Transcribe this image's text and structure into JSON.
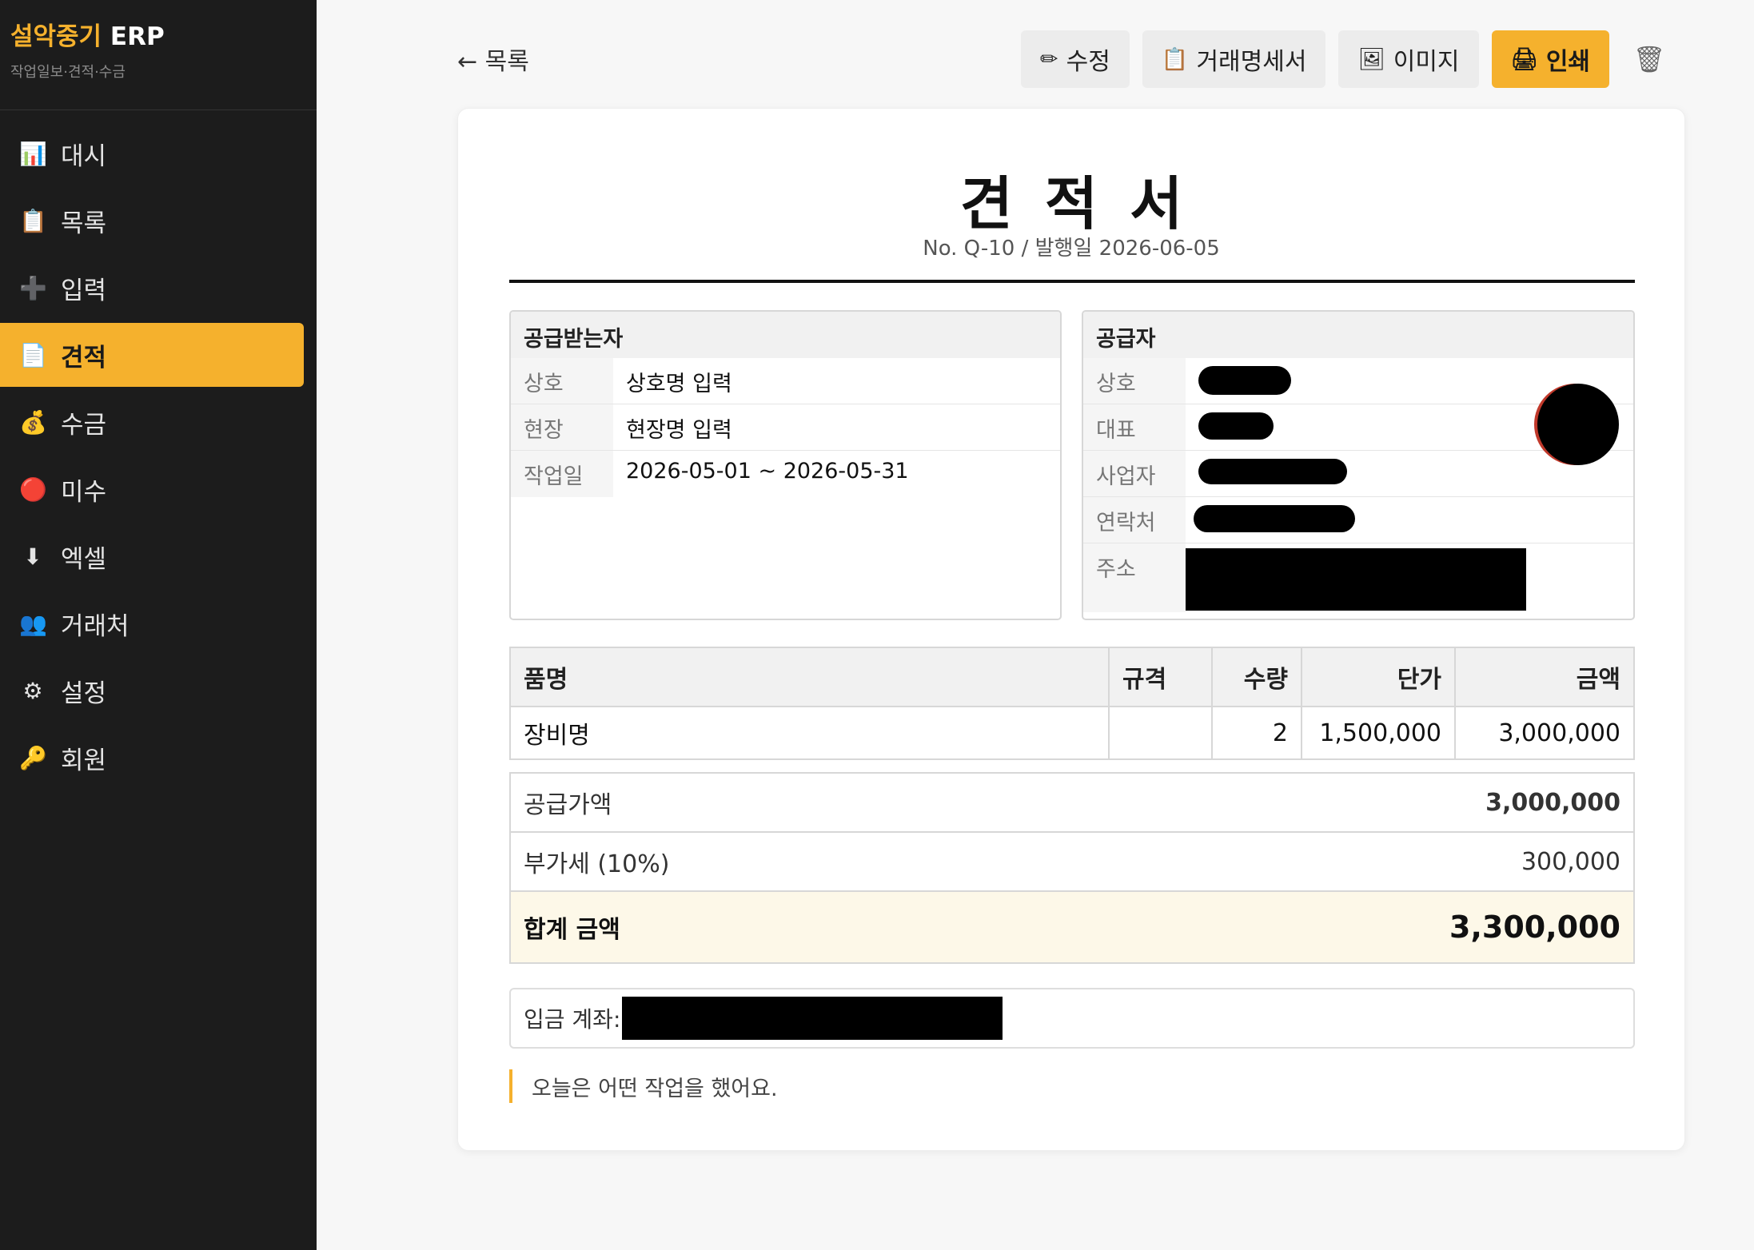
{
  "sidebar": {
    "brand_accent": "설악중기",
    "brand_rest": "ERP",
    "subtitle": "작업일보·견적·수금",
    "items": [
      {
        "icon": "📊",
        "label": "대시"
      },
      {
        "icon": "📋",
        "label": "목록"
      },
      {
        "icon": "➕",
        "label": "입력"
      },
      {
        "icon": "📄",
        "label": "견적"
      },
      {
        "icon": "💰",
        "label": "수금"
      },
      {
        "icon": "🔴",
        "label": "미수"
      },
      {
        "icon": "⬇",
        "label": "엑셀"
      },
      {
        "icon": "👥",
        "label": "거래처"
      },
      {
        "icon": "⚙",
        "label": "설정"
      },
      {
        "icon": "🔑",
        "label": "회원"
      }
    ],
    "active": "견적"
  },
  "toolbar": {
    "back_label": "← 목록",
    "edit": {
      "icon": "✏",
      "label": "수정"
    },
    "statement": {
      "icon": "📋",
      "label": "거래명세서"
    },
    "image": {
      "icon": "🖼",
      "label": "이미지"
    },
    "print": {
      "icon": "🖨",
      "label": "인쇄"
    },
    "delete_icon": "🗑"
  },
  "doc": {
    "title": "견적서",
    "subtitle": "No. Q-10 / 발행일 2026-06-05",
    "receiver": {
      "heading": "공급받는자",
      "rows": [
        {
          "k": "상호",
          "v": "상호명 입력"
        },
        {
          "k": "현장",
          "v": "현장명 입력"
        },
        {
          "k": "작업일",
          "v": "2026-05-01 ~ 2026-05-31"
        }
      ]
    },
    "supplier": {
      "heading": "공급자",
      "labels": [
        "상호",
        "대표",
        "사업자",
        "연락처",
        "주소"
      ]
    },
    "items": {
      "headers": [
        "품명",
        "규격",
        "수량",
        "단가",
        "금액"
      ],
      "rows": [
        {
          "name": "장비명",
          "spec": "",
          "qty": "2",
          "price": "1,500,000",
          "amount": "3,000,000"
        }
      ]
    },
    "totals": {
      "supply_label": "공급가액",
      "supply_value": "3,000,000",
      "vat_label": "부가세 (10%)",
      "vat_value": "300,000",
      "total_label": "합계 금액",
      "total_value": "3,300,000"
    },
    "account_label": "입금 계좌:",
    "memo": "오늘은 어떤 작업을 했어요."
  },
  "colors": {
    "accent": "#f5b12d",
    "sidebar_bg": "#1c1c1c"
  }
}
